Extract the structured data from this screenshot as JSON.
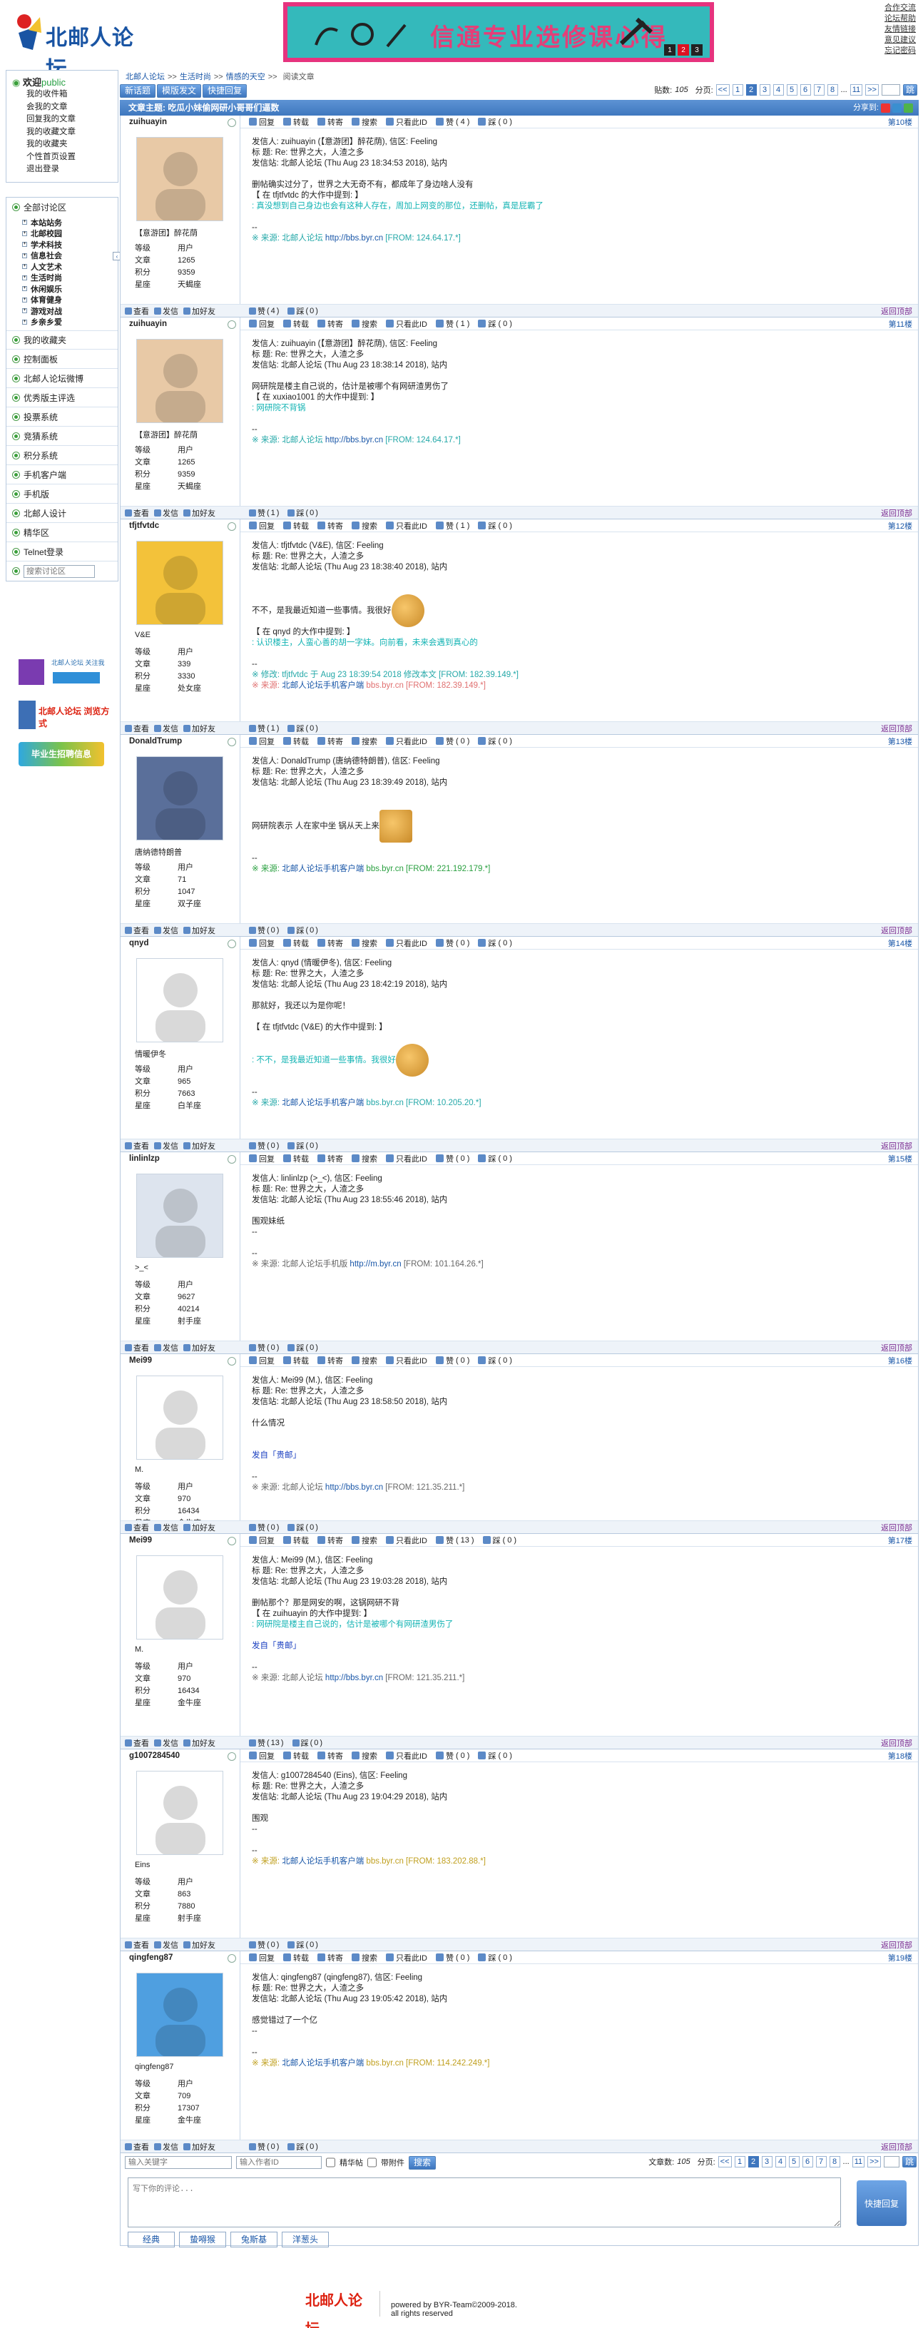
{
  "site": {
    "logo_text": "北邮人论坛",
    "banner_text": "信通专业选修课心得",
    "banner_pages": [
      "1",
      "2",
      "3"
    ]
  },
  "top_links": [
    "合作交流",
    "论坛帮助",
    "友情链接",
    "意见建议",
    "忘记密码"
  ],
  "welcome": {
    "label": "欢迎",
    "user": "public",
    "links": [
      "我的收件箱",
      "会我的文章",
      "回复我的文章",
      "我的收藏文章",
      "我的收藏夹",
      "个性首页设置",
      "退出登录"
    ]
  },
  "menu": {
    "all": "全部讨论区",
    "subs": [
      "本站站务",
      "北邮校园",
      "学术科技",
      "信息社会",
      "人文艺术",
      "生活时尚",
      "休闲娱乐",
      "体育健身",
      "游戏对战",
      "乡亲乡爱"
    ],
    "items": [
      "我的收藏夹",
      "控制面板",
      "北邮人论坛微博",
      "优秀版主评选",
      "投票系统",
      "竞猜系统",
      "积分系统",
      "手机客户端",
      "手机版",
      "北邮人设计",
      "精华区",
      "Telnet登录"
    ],
    "search_placeholder": "搜索讨论区"
  },
  "promo": {
    "weibo": "北邮人论坛 关注我",
    "browse": "北邮人论坛 浏览方式",
    "grad": "毕业生招聘信息"
  },
  "breadcrumb": [
    "北邮人论坛",
    "生活时尚",
    "情感的天空",
    "阅读文章"
  ],
  "sep": ">>",
  "buttons": {
    "new": "新话题",
    "template": "模版发文",
    "quick": "快捷回复"
  },
  "pager": {
    "count_label": "贴数:",
    "count": "105",
    "page_label": "分页:",
    "prev": "<<",
    "pages": [
      "1",
      "2",
      "3",
      "4",
      "5",
      "6",
      "7",
      "8",
      "...",
      "11",
      ">>"
    ],
    "current": "2",
    "go": "跳"
  },
  "topic": {
    "title": "文章主题: 吃瓜小妹偷网研小哥哥们逼数",
    "share": "分享到:"
  },
  "actions": {
    "reply": "回复",
    "mail": "转载",
    "fwd": "转寄",
    "search": "搜索",
    "only": "只看此ID",
    "like": "赞",
    "dislike": "踩",
    "view": "查看",
    "letter": "发信",
    "friend": "加好友",
    "top": "返回顶部"
  },
  "stat_labels": [
    "等级",
    "文章",
    "积分",
    "星座"
  ],
  "posts": [
    {
      "user": "zuihuayin",
      "floor": "第10楼",
      "nick": "【意游团】醉花荫",
      "level": "用户",
      "posts": "1265",
      "score": "9359",
      "star": "天蝎座",
      "like": "4",
      "dislike": "0",
      "lines": [
        "发信人: zuihuayin (【意游团】醉花荫), 信区: Feeling",
        "标  题: Re: 世界之大，人渣之多",
        "发信站: 北邮人论坛 (Thu Aug 23 18:34:53 2018), 站内",
        "",
        "删帖确实过分了，世界之大无奇不有，都成年了身边啥人没有",
        "【 在 tfjtfvtdc 的大作中提到: 】"
      ],
      "quote": ": 真没想到自己身边也会有这种人存在，周加上网变的那位，还删帖，真是屁霸了",
      "src_prefix": "※ 来源: 北邮人论坛 ",
      "src_link": "http://bbs.byr.cn",
      "src_from": " [FROM: 124.64.17.*]"
    },
    {
      "user": "zuihuayin",
      "floor": "第11楼",
      "nick": "【意游团】醉花荫",
      "level": "用户",
      "posts": "1265",
      "score": "9359",
      "star": "天蝎座",
      "like": "1",
      "dislike": "0",
      "lines": [
        "发信人: zuihuayin (【意游团】醉花荫), 信区: Feeling",
        "标  题: Re: 世界之大，人渣之多",
        "发信站: 北邮人论坛 (Thu Aug 23 18:38:14 2018), 站内",
        "",
        "网研院是楼主自己说的，估计是被哪个有网研渣男伤了",
        "【 在 xuxiao1001 的大作中提到: 】"
      ],
      "quote": ": 网研院不背锅",
      "src_prefix": "※ 来源: 北邮人论坛 ",
      "src_link": "http://bbs.byr.cn",
      "src_from": " [FROM: 124.64.17.*]"
    },
    {
      "user": "tfjtfvtdc",
      "floor": "第12楼",
      "nick": "V&E",
      "level": "用户",
      "posts": "339",
      "score": "3330",
      "star": "处女座",
      "like": "1",
      "dislike": "0",
      "lines": [
        "发信人: tfjtfvtdc (V&E), 信区: Feeling",
        "标  题: Re: 世界之大，人渣之多",
        "发信站: 北邮人论坛 (Thu Aug 23 18:38:40 2018), 站内",
        "",
        "",
        "不不，是我最近知道一些事情。我很好",
        "【 在 qnyd 的大作中提到: 】"
      ],
      "quote": ": 认识楼主，人蛮心善的胡一字妹。向前看，未来会遇到真心的",
      "edit": "※ 修改: tfjtfvtdc 于 Aug 23 18:39:54 2018 修改本文 [FROM: 182.39.149.*]",
      "src_prefix": "※ 来源: ",
      "src_link": "北邮人论坛手机客户端",
      "src_tail": " bbs.byr.cn",
      "src_from": " [FROM: 182.39.149.*]"
    },
    {
      "user": "DonaldTrump",
      "floor": "第13楼",
      "nick": "唐纳德特朗普",
      "level": "用户",
      "posts": "71",
      "score": "1047",
      "star": "双子座",
      "like": "0",
      "dislike": "0",
      "lines": [
        "发信人: DonaldTrump (唐纳德特朗普), 信区: Feeling",
        "标  题: Re: 世界之大，人渣之多",
        "发信站: 北邮人论坛 (Thu Aug 23 18:39:49 2018), 站内",
        "",
        "",
        "网研院表示 人在家中坐 锅从天上来"
      ],
      "src_prefix": "※ 来源: ",
      "src_link": "北邮人论坛手机客户端",
      "src_tail": " bbs.byr.cn",
      "src_from": " [FROM: 221.192.179.*]"
    },
    {
      "user": "qnyd",
      "floor": "第14楼",
      "nick": "情暖伊冬",
      "level": "用户",
      "posts": "965",
      "score": "7663",
      "star": "白羊座",
      "like": "0",
      "dislike": "0",
      "lines": [
        "发信人: qnyd (情暖伊冬), 信区: Feeling",
        "标  题: Re: 世界之大，人渣之多",
        "发信站: 北邮人论坛 (Thu Aug 23 18:42:19 2018), 站内",
        "",
        "那就好，我还以为是你呢！",
        "",
        "【 在 tfjtfvtdc (V&E) 的大作中提到: 】"
      ],
      "quote": ": 不不，是我最近知道一些事情。我很好",
      "src_prefix": "※ 来源: ",
      "src_link": "北邮人论坛手机客户端",
      "src_tail": " bbs.byr.cn",
      "src_from": " [FROM: 10.205.20.*]"
    },
    {
      "user": "linlinlzp",
      "floor": "第15楼",
      "nick": ">_<",
      "level": "用户",
      "posts": "9627",
      "score": "40214",
      "star": "射手座",
      "like": "0",
      "dislike": "0",
      "lines": [
        "发信人: linlinlzp (>_<), 信区: Feeling",
        "标  题: Re: 世界之大，人渣之多",
        "发信站: 北邮人论坛 (Thu Aug 23 18:55:46 2018), 站内",
        "",
        "围观妹纸",
        "--"
      ],
      "src_prefix": "※ 来源: 北邮人论坛手机版 ",
      "src_link": "http://m.byr.cn",
      "src_from": " [FROM: 101.164.26.*]"
    },
    {
      "user": "Mei99",
      "floor": "第16楼",
      "nick": "M.",
      "level": "用户",
      "posts": "970",
      "score": "16434",
      "star": "金牛座",
      "like": "0",
      "dislike": "0",
      "lines": [
        "发信人: Mei99 (M.), 信区: Feeling",
        "标  题: Re: 世界之大，人渣之多",
        "发信站: 北邮人论坛 (Thu Aug 23 18:58:50 2018), 站内",
        "",
        "什么情况",
        ""
      ],
      "from": "发自「贵邮」",
      "src_prefix": "※ 来源: 北邮人论坛 ",
      "src_link": "http://bbs.byr.cn",
      "src_from": " [FROM: 121.35.211.*]"
    },
    {
      "user": "Mei99",
      "floor": "第17楼",
      "nick": "M.",
      "level": "用户",
      "posts": "970",
      "score": "16434",
      "star": "金牛座",
      "like": "13",
      "dislike": "0",
      "lines": [
        "发信人: Mei99 (M.), 信区: Feeling",
        "标  题: Re: 世界之大，人渣之多",
        "发信站: 北邮人论坛 (Thu Aug 23 19:03:28 2018), 站内",
        "",
        "删帖那个？那是网安的啊，这锅网研不背",
        "【 在 zuihuayin 的大作中提到: 】"
      ],
      "quote": ": 网研院是楼主自己说的，估计是被哪个有网研渣男伤了",
      "from": "发自「贵邮」",
      "src_prefix": "※ 来源: 北邮人论坛 ",
      "src_link": "http://bbs.byr.cn",
      "src_from": " [FROM: 121.35.211.*]"
    },
    {
      "user": "g1007284540",
      "floor": "第18楼",
      "nick": "Eins",
      "level": "用户",
      "posts": "863",
      "score": "7880",
      "star": "射手座",
      "like": "0",
      "dislike": "0",
      "lines": [
        "发信人: g1007284540 (Eins), 信区: Feeling",
        "标  题: Re: 世界之大，人渣之多",
        "发信站: 北邮人论坛 (Thu Aug 23 19:04:29 2018), 站内",
        "",
        "围观",
        "--"
      ],
      "src_prefix": "※ 来源: ",
      "src_link": "北邮人论坛手机客户端",
      "src_tail": " bbs.byr.cn",
      "src_from": " [FROM: 183.202.88.*]"
    },
    {
      "user": "qingfeng87",
      "floor": "第19楼",
      "nick": "qingfeng87",
      "level": "用户",
      "posts": "709",
      "score": "17307",
      "star": "金牛座",
      "like": "0",
      "dislike": "0",
      "lines": [
        "发信人: qingfeng87 (qingfeng87), 信区: Feeling",
        "标  题: Re: 世界之大，人渣之多",
        "发信站: 北邮人论坛 (Thu Aug 23 19:05:42 2018), 站内",
        "",
        "感觉错过了一个亿",
        "--"
      ],
      "src_prefix": "※ 来源: ",
      "src_link": "北邮人论坛手机客户端",
      "src_tail": " bbs.byr.cn",
      "src_from": " [FROM: 114.242.249.*]"
    }
  ],
  "bottom": {
    "kw_placeholder": "输入关键字",
    "author_placeholder": "输入作者ID",
    "digest": "精华帖",
    "attach": "带附件",
    "search": "搜索",
    "count_label": "文章数:",
    "reply_placeholder": "写下你的评论...",
    "reply_btn": "快捷回复",
    "tabs": [
      "经典",
      "蛰嘚猴",
      "兔斯基",
      "洋葱头"
    ]
  },
  "footer": {
    "logo": "北邮人论坛",
    "line1": "powered by BYR-Team©2009-2018.",
    "line2": "all rights reserved"
  }
}
